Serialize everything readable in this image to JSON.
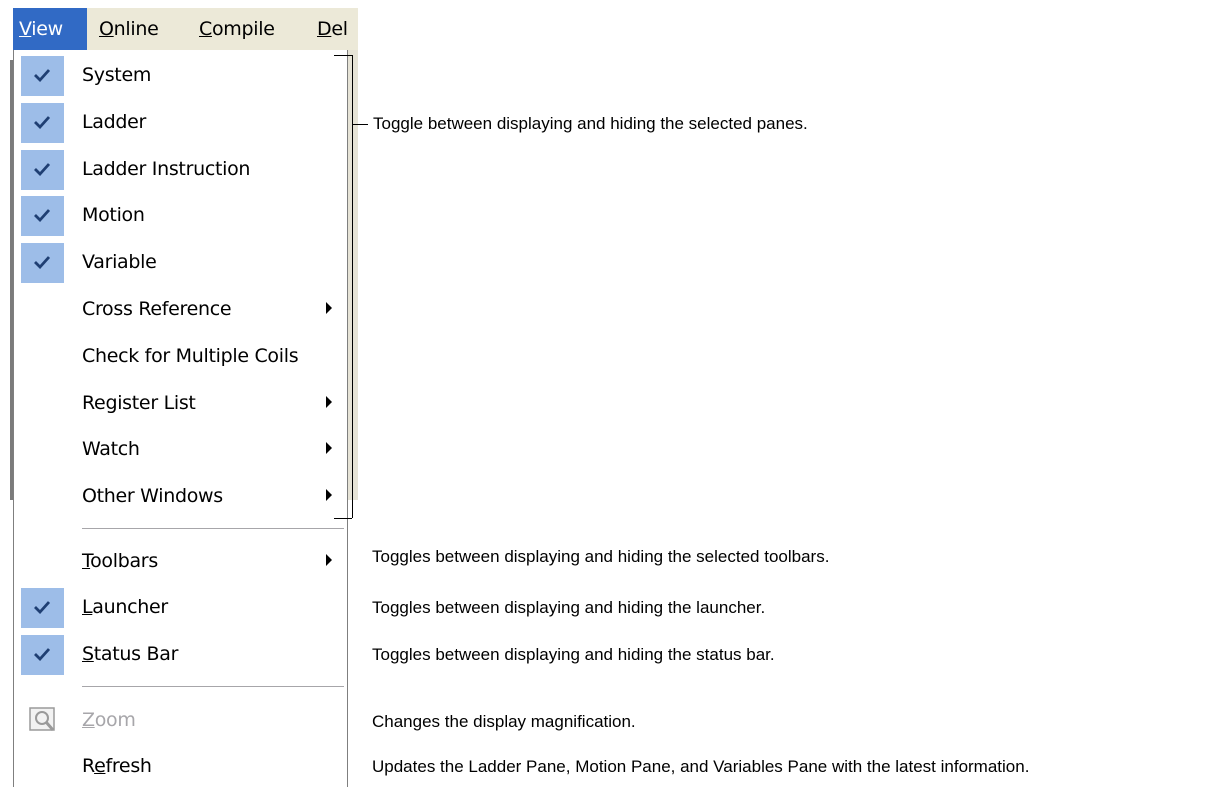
{
  "menubar": {
    "items": [
      {
        "label": "View"
      },
      {
        "label": "Online"
      },
      {
        "label": "Compile"
      },
      {
        "label": "Del"
      }
    ]
  },
  "menu": {
    "items": [
      {
        "label": "System",
        "checked": true
      },
      {
        "label": "Ladder",
        "checked": true
      },
      {
        "label": "Ladder Instruction",
        "checked": true
      },
      {
        "label": "Motion",
        "checked": true
      },
      {
        "label": "Variable",
        "checked": true
      },
      {
        "label": "Cross Reference",
        "submenu": true
      },
      {
        "label": "Check for Multiple Coils"
      },
      {
        "label": "Register List",
        "submenu": true
      },
      {
        "label": "Watch",
        "submenu": true
      },
      {
        "label": "Other Windows",
        "submenu": true
      },
      {
        "label": "Toolbars",
        "submenu": true
      },
      {
        "label": "Launcher",
        "checked": true
      },
      {
        "label": "Status Bar",
        "checked": true
      },
      {
        "label": "Zoom",
        "disabled": true,
        "icon": "zoom-icon"
      },
      {
        "label": "Refresh"
      }
    ]
  },
  "annotations": {
    "panes": "Toggle between displaying and hiding the selected panes.",
    "toolbars": "Toggles between displaying and hiding the selected toolbars.",
    "launcher": "Toggles between displaying and hiding the launcher.",
    "status_bar": "Toggles between displaying and hiding the status bar.",
    "zoom": "Changes the display magnification.",
    "refresh": "Updates the Ladder Pane, Motion Pane, and Variables Pane with the latest information."
  },
  "colors": {
    "menubar_bg": "#ece9d8",
    "active_menu": "#316ac5",
    "check_highlight": "#9dbde8",
    "disabled_text": "#a7a6aa"
  }
}
